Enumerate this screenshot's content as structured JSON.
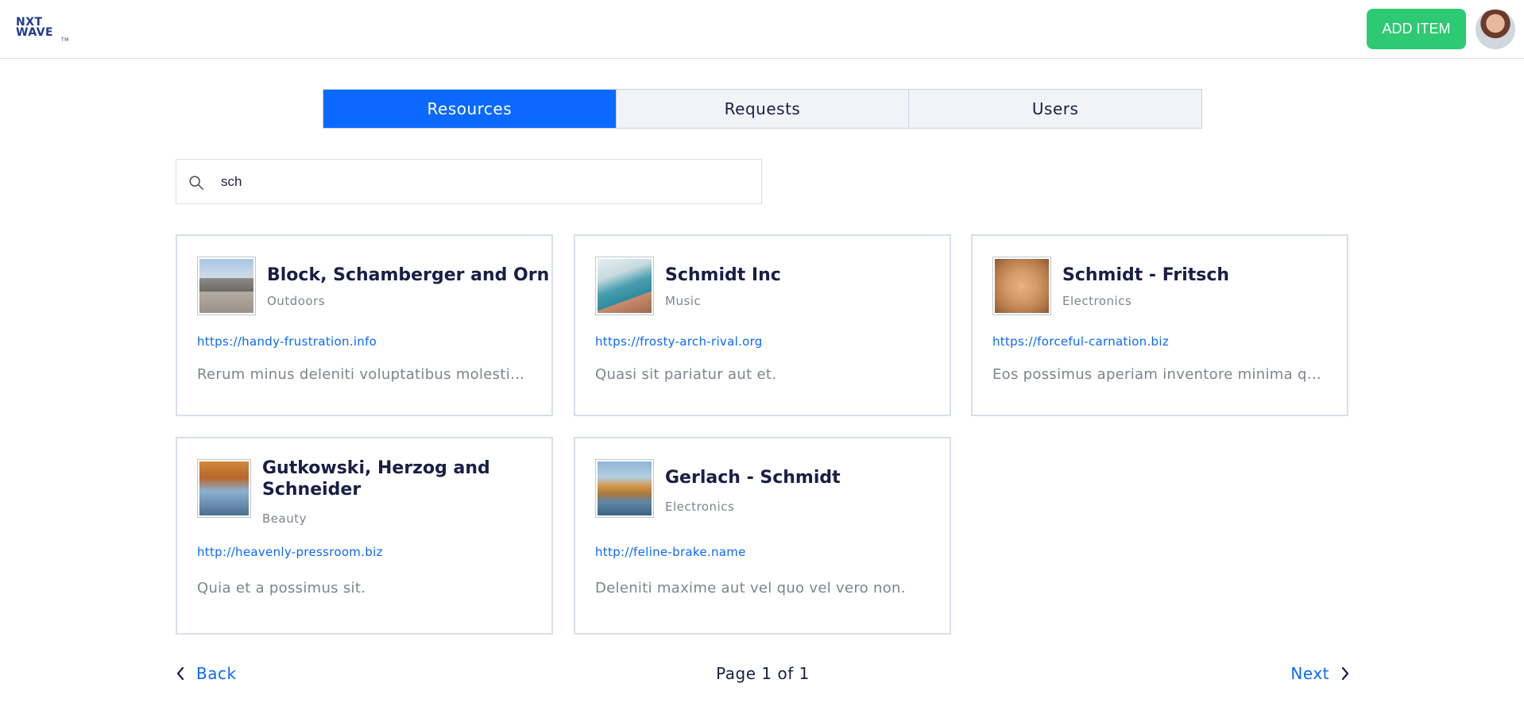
{
  "header": {
    "logo_line1": "NXT",
    "logo_line2": "WAVE",
    "logo_tm": "TM",
    "add_item_label": "ADD ITEM"
  },
  "tabs": [
    {
      "label": "Resources",
      "active": true
    },
    {
      "label": "Requests",
      "active": false
    },
    {
      "label": "Users",
      "active": false
    }
  ],
  "search": {
    "value": "sch",
    "placeholder": "Search"
  },
  "resources": [
    {
      "title": "Block, Schamberger and Orn",
      "category": "Outdoors",
      "link": "https://handy-frustration.info",
      "description": "Rerum minus deleniti voluptatibus molestias asperiores.",
      "thumbnail": "street-photo"
    },
    {
      "title": "Schmidt Inc",
      "category": "Music",
      "link": "https://frosty-arch-rival.org",
      "description": "Quasi sit pariatur aut et.",
      "thumbnail": "beach-photo"
    },
    {
      "title": "Schmidt - Fritsch",
      "category": "Electronics",
      "link": "https://forceful-carnation.biz",
      "description": "Eos possimus aperiam inventore minima quibusdam.",
      "thumbnail": "cat-photo"
    },
    {
      "title": "Gutkowski, Herzog and Schneider",
      "category": "Beauty",
      "link": "http://heavenly-pressroom.biz",
      "description": "Quia et a possimus sit.",
      "thumbnail": "autumn-tree-photo"
    },
    {
      "title": "Gerlach - Schmidt",
      "category": "Electronics",
      "link": "http://feline-brake.name",
      "description": "Deleniti maxime aut vel quo vel vero non.",
      "thumbnail": "lake-photo"
    }
  ],
  "pagination": {
    "back_label": "Back",
    "page_text": "Page 1 of 1",
    "next_label": "Next"
  },
  "colors": {
    "primary": "#0b69ff",
    "add_button": "#2dca73",
    "text_dark": "#171f46",
    "text_muted": "#7e858e",
    "border": "#d7dfe9"
  }
}
